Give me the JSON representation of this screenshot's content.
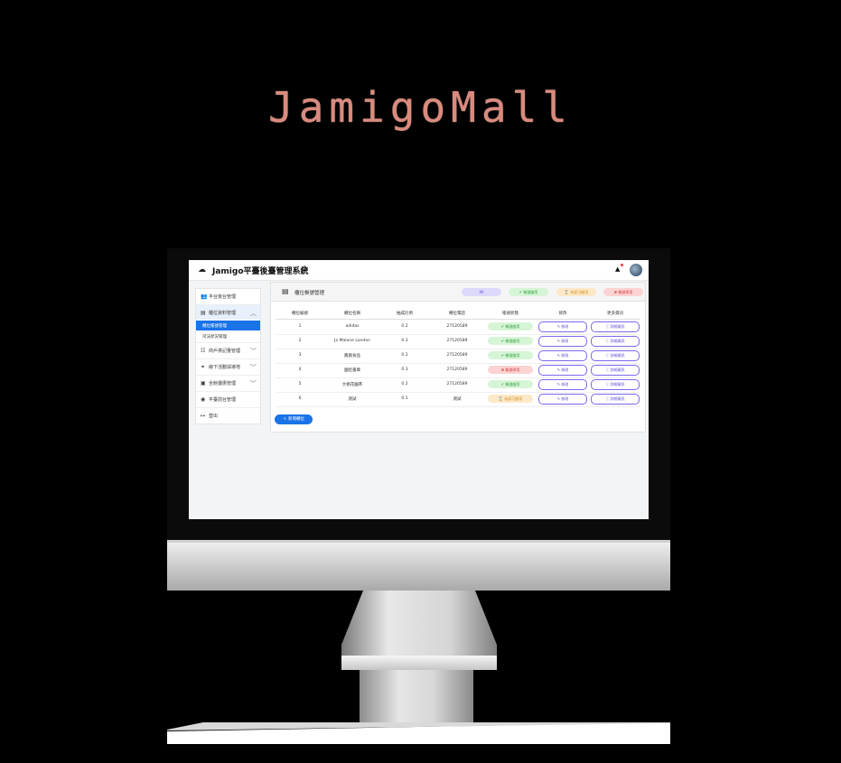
{
  "brand": "JamigoMall",
  "app": {
    "title": "Jamigo平臺後臺管理系統"
  },
  "sidebar": {
    "items": [
      {
        "label": "平台後台管理",
        "icon": "users-icon"
      },
      {
        "label": "櫃位資料管理",
        "icon": "store-icon"
      },
      {
        "label": "櫃位帳號管理"
      },
      {
        "label": "司法狀況管理"
      },
      {
        "label": "商戶排記量管理",
        "icon": "grid-icon"
      },
      {
        "label": "線下活動與導地",
        "icon": "binoculars-icon"
      },
      {
        "label": "全館優惠管理",
        "icon": "tag-icon"
      },
      {
        "label": "平臺前台管理",
        "icon": "eye-icon"
      },
      {
        "label": "登出",
        "icon": "logout-icon"
      }
    ]
  },
  "panel": {
    "title": "櫃位帳號管理",
    "filters": [
      {
        "label": "All",
        "bg": "#ddd9fb",
        "fg": "#5b4bd6"
      },
      {
        "label": "✔ 帳號啟用",
        "bg": "#d6f5d6",
        "fg": "#2e9e3e"
      },
      {
        "label": "⌛ 未認可啟用",
        "bg": "#fde8c7",
        "fg": "#d48a1a"
      },
      {
        "label": "✖ 帳號停用",
        "bg": "#fbd3d3",
        "fg": "#d43a3a"
      }
    ],
    "columns": [
      "櫃位編號",
      "櫃位名稱",
      "抽成比例",
      "櫃位電話",
      "帳號狀態",
      "修改",
      "更多資訊"
    ],
    "rows": [
      {
        "id": "1",
        "name": "adidas",
        "rate": "0.2",
        "phone": "27120589",
        "status": "帳號啟用",
        "edit": "修改",
        "more": "詳細資訊"
      },
      {
        "id": "2",
        "name": "Jo Malone London",
        "rate": "0.3",
        "phone": "27120589",
        "status": "帳號啟用",
        "edit": "修改",
        "more": "詳細資訊"
      },
      {
        "id": "3",
        "name": "鳳凰食品",
        "rate": "0.2",
        "phone": "27120589",
        "status": "帳號啟用",
        "edit": "修改",
        "more": "詳細資訊"
      },
      {
        "id": "4",
        "name": "國娃書庫",
        "rate": "0.3",
        "phone": "27120589",
        "status": "帳號停用",
        "edit": "修改",
        "more": "詳細資訊"
      },
      {
        "id": "5",
        "name": "大樹花園茶",
        "rate": "0.2",
        "phone": "27120589",
        "status": "帳號啟用",
        "edit": "修改",
        "more": "詳細資訊"
      },
      {
        "id": "6",
        "name": "測試",
        "rate": "0.1",
        "phone": "測試",
        "status": "未認可啟用",
        "edit": "修改",
        "more": "詳細資訊"
      }
    ],
    "add_label": "新增櫃位"
  },
  "status_colors": {
    "帳號啟用": {
      "bg": "#d6f5d6",
      "fg": "#2e9e3e",
      "icon": "✔"
    },
    "帳號停用": {
      "bg": "#fbd3d3",
      "fg": "#d43a3a",
      "icon": "✖"
    },
    "未認可啟用": {
      "bg": "#fde8c7",
      "fg": "#d48a1a",
      "icon": "⌛"
    }
  }
}
